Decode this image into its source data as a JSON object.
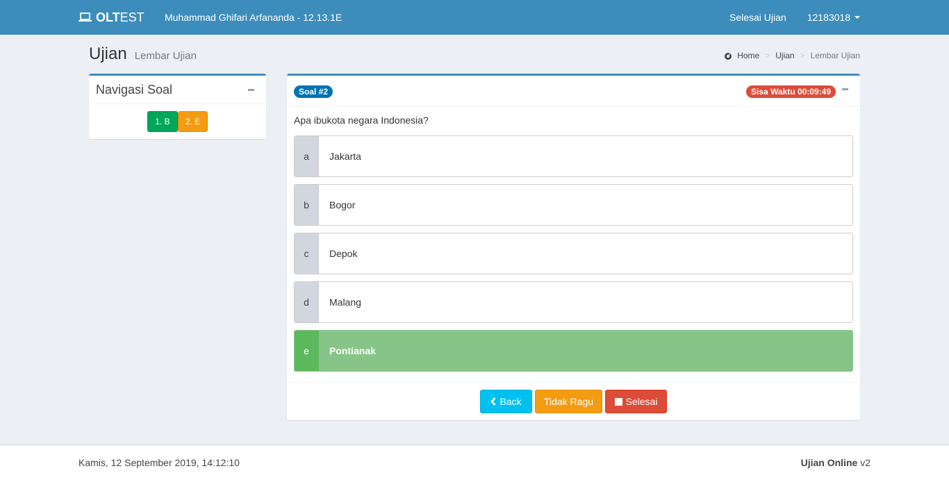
{
  "navbar": {
    "brand_bold": "OLT",
    "brand_rest": "EST",
    "user_info": "Muhammad Ghifari Arfananda - 12.13.1E",
    "selesai_link": "Selesai Ujian",
    "user_id": "12183018"
  },
  "header": {
    "title": "Ujian",
    "subtitle": "Lembar Ujian",
    "breadcrumb": [
      "Home",
      "Ujian",
      "Lembar Ujian"
    ]
  },
  "nav_box": {
    "title": "Navigasi Soal",
    "buttons": [
      {
        "label": "1. B",
        "status": "answered"
      },
      {
        "label": "2. E",
        "status": "doubt"
      }
    ]
  },
  "question_box": {
    "badge": "Soal #2",
    "timer": "Sisa Waktu 00:09:49",
    "question": "Apa ibukota negara Indonesia?",
    "options": [
      {
        "key": "a",
        "text": "Jakarta"
      },
      {
        "key": "b",
        "text": "Bogor"
      },
      {
        "key": "c",
        "text": "Depok"
      },
      {
        "key": "d",
        "text": "Malang"
      },
      {
        "key": "e",
        "text": "Pontianak"
      }
    ],
    "selected": "e",
    "buttons": {
      "back": "Back",
      "ragu": "Tidak Ragu",
      "selesai": "Selesai"
    }
  },
  "footer": {
    "datetime": "Kamis, 12 September 2019, 14:12:10",
    "app_name": "Ujian Online",
    "version": "v2"
  },
  "colors": {
    "primary": "#3c8dbc",
    "success": "#00a65a",
    "warning": "#f39c12",
    "danger": "#dd4b39",
    "info": "#00c0ef",
    "selected_option": "#86c587"
  }
}
